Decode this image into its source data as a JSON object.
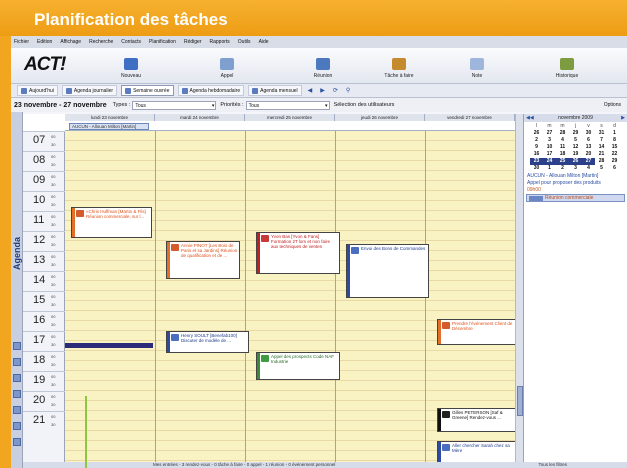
{
  "banner": {
    "title": "Planification des tâches"
  },
  "menu": [
    "Fichier",
    "Edition",
    "Affichage",
    "Recherche",
    "Contacts",
    "Planification",
    "Rédiger",
    "Rapports",
    "Outils",
    "Aide"
  ],
  "toolbar": {
    "logo": "ACT!",
    "buttons": [
      {
        "label": "Nouveau",
        "color": "#3f6fc4"
      },
      {
        "label": "Appel",
        "color": "#7fa0cf"
      },
      {
        "label": "Réunion",
        "color": "#4c78c0"
      },
      {
        "label": "Tâche à faire",
        "color": "#c58a2e"
      },
      {
        "label": "Note",
        "color": "#9fb6dc"
      },
      {
        "label": "Historique",
        "color": "#7d9b3f"
      }
    ]
  },
  "tabs": [
    "Aujourd'hui",
    "Agenda journalier",
    "Semaine ouvrée",
    "Agenda hebdomadaire",
    "Agenda mensuel"
  ],
  "filter": {
    "range": "23 novembre - 27 novembre",
    "types_label": "Types :",
    "types_value": "Tous",
    "priority_label": "Priorités :",
    "priority_value": "Tous",
    "users_button": "Sélection des utilisateurs",
    "options": "Options"
  },
  "side_label": "Agenda",
  "days": [
    "lundi 23 novembre",
    "mardi 24 novembre",
    "mercredi 25 novembre",
    "jeudi 26 novembre",
    "vendredi 27 novembre"
  ],
  "allday": "AUCUN - Allouan Milton [Martin]",
  "hours": [
    "07",
    "08",
    "09",
    "10",
    "11",
    "12",
    "13",
    "14",
    "15",
    "16",
    "17",
    "18",
    "19",
    "20",
    "21"
  ],
  "minutes": [
    "00",
    "30"
  ],
  "appointments": [
    {
      "text": "«Chris Huffman [Martin & Fils] Réunion commerciale, sur l...",
      "color": "orange"
    },
    {
      "text": "Annie PINOT [Les Bois de Paris et sa Jardins] Réunion de qualification et de ...",
      "color": "orange"
    },
    {
      "text": "Henry SOULT [Benefab100] Discuter de modèle de ...",
      "color": "blue"
    },
    {
      "text": "Yvon Bas [Yvon & Fans] Formation 2T lors et non faire aux techniques de ventes",
      "color": "red"
    },
    {
      "text": "Appel des prospects Code NAF Industrie",
      "color": "green"
    },
    {
      "text": "Envoi des Bons de Commandes",
      "color": "blue"
    },
    {
      "text": "Prendre l'événement Client de Décembre",
      "color": "orange"
    },
    {
      "text": "Gilles PETERSON [Saf & Greene] Rendez-vous ...",
      "color": "black"
    },
    {
      "text": "Aller chercher Sarah chez sa Mère",
      "color": "blue"
    }
  ],
  "minical": {
    "month": "novembre 2009",
    "weekdays": [
      "l",
      "m",
      "m",
      "j",
      "v",
      "s",
      "d"
    ],
    "days": [
      "26",
      "27",
      "28",
      "29",
      "30",
      "31",
      "1",
      "2",
      "3",
      "4",
      "5",
      "6",
      "7",
      "8",
      "9",
      "10",
      "11",
      "12",
      "13",
      "14",
      "15",
      "16",
      "17",
      "18",
      "19",
      "20",
      "21",
      "22",
      "23",
      "24",
      "25",
      "26",
      "27",
      "28",
      "29",
      "30",
      "1",
      "2",
      "3",
      "4",
      "5",
      "6"
    ]
  },
  "right_panel": {
    "task1": "AUCUN - Allouan Milton [Martin]",
    "task2": "Appel pour proposer des produits",
    "task2_time": "09h00",
    "meeting": "Réunion commerciale"
  },
  "statusbar": "Mes entrées - 3 rendez-vous - 0 tâche à faire - 0 appel - 1 réunion - 0 événement personnel",
  "statusbar_right": "Tous les filtres"
}
